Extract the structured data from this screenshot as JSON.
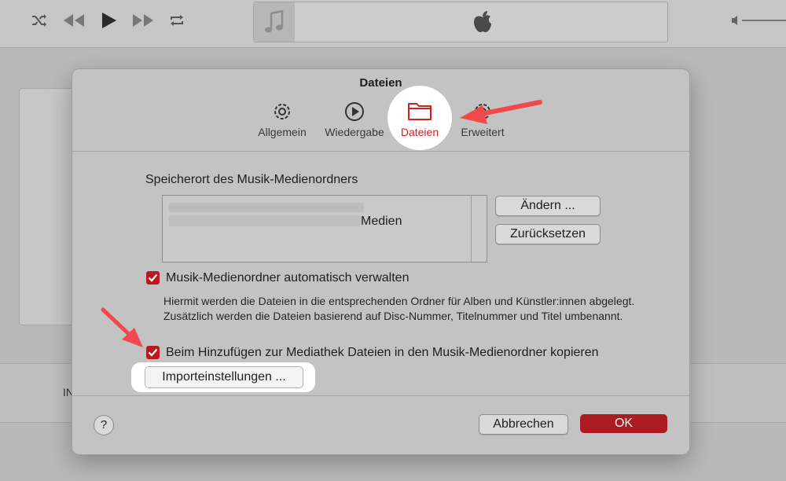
{
  "player": {
    "controls": [
      {
        "name": "shuffle-icon"
      },
      {
        "name": "previous-icon"
      },
      {
        "name": "play-icon"
      },
      {
        "name": "next-icon"
      },
      {
        "name": "repeat-icon"
      }
    ],
    "lcd_icons": [
      "music-note-icon",
      "apple-logo-icon"
    ]
  },
  "background": {
    "strip_text": "IN"
  },
  "dialog": {
    "title": "Dateien",
    "tabs": [
      {
        "label": "Allgemein",
        "icon": "gear-icon"
      },
      {
        "label": "Wiedergabe",
        "icon": "play-circle-icon"
      },
      {
        "label": "Dateien",
        "icon": "folder-icon",
        "selected": true
      },
      {
        "label": "Erweitert",
        "icon": "advanced-gear-icon"
      }
    ],
    "location_label": "Speicherort des Musik-Medienordners",
    "path_text": "Medien",
    "change_button": "Ändern ...",
    "reset_button": "Zurücksetzen",
    "manage_checkbox": {
      "label": "Musik-Medienordner automatisch verwalten",
      "checked": true
    },
    "manage_description": "Hiermit werden die Dateien in die entsprechenden Ordner für Alben und Künstler:innen abgelegt. Zusätzlich werden die Dateien basierend auf Disc-Nummer, Titelnummer und Titel umbenannt.",
    "copy_checkbox": {
      "label": "Beim Hinzufügen zur Mediathek Dateien in den Musik-Medienordner kopieren",
      "checked": true
    },
    "import_button": "Importeinstellungen ...",
    "help_button": "?",
    "cancel_button": "Abbrechen",
    "ok_button": "OK"
  },
  "colors": {
    "accent": "#ad1b22",
    "highlight": "#ffffff",
    "annotation_arrow": "#f0484b"
  }
}
